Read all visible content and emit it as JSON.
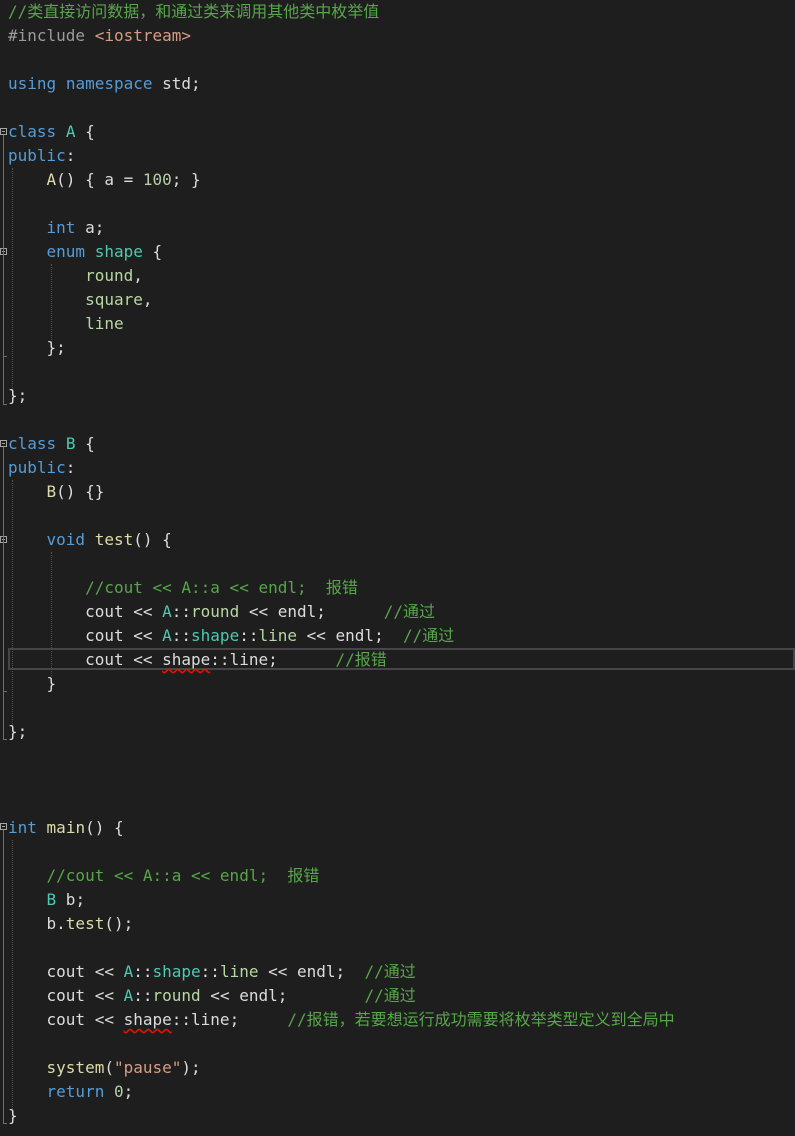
{
  "editor": {
    "language": "cpp",
    "lines": [
      {
        "row": 0,
        "tokens": [
          {
            "t": "//类直接访问数据，和通过类来调用其他类中枚举值",
            "c": "c"
          }
        ]
      },
      {
        "row": 1,
        "tokens": [
          {
            "t": "#include",
            "c": "p"
          },
          {
            "t": " <iostream>",
            "c": "s"
          }
        ]
      },
      {
        "row": 3,
        "tokens": [
          {
            "t": "using",
            "c": "k"
          },
          {
            "t": " ",
            "c": "v"
          },
          {
            "t": "namespace",
            "c": "k"
          },
          {
            "t": " std;",
            "c": "v"
          }
        ]
      },
      {
        "row": 5,
        "tokens": [
          {
            "t": "class",
            "c": "k"
          },
          {
            "t": " ",
            "c": "v"
          },
          {
            "t": "A",
            "c": "t"
          },
          {
            "t": " {",
            "c": "v"
          }
        ]
      },
      {
        "row": 6,
        "tokens": [
          {
            "t": "public",
            "c": "k"
          },
          {
            "t": ":",
            "c": "v"
          }
        ]
      },
      {
        "row": 7,
        "tokens": [
          {
            "t": "    ",
            "c": "v"
          },
          {
            "t": "A",
            "c": "f"
          },
          {
            "t": "() { a = ",
            "c": "v"
          },
          {
            "t": "100",
            "c": "n"
          },
          {
            "t": "; }",
            "c": "v"
          }
        ]
      },
      {
        "row": 9,
        "tokens": [
          {
            "t": "    ",
            "c": "v"
          },
          {
            "t": "int",
            "c": "k"
          },
          {
            "t": " a;",
            "c": "v"
          }
        ]
      },
      {
        "row": 10,
        "tokens": [
          {
            "t": "    ",
            "c": "v"
          },
          {
            "t": "enum",
            "c": "k"
          },
          {
            "t": " ",
            "c": "v"
          },
          {
            "t": "shape",
            "c": "t"
          },
          {
            "t": " {",
            "c": "v"
          }
        ]
      },
      {
        "row": 11,
        "tokens": [
          {
            "t": "        ",
            "c": "v"
          },
          {
            "t": "round",
            "c": "e"
          },
          {
            "t": ",",
            "c": "v"
          }
        ]
      },
      {
        "row": 12,
        "tokens": [
          {
            "t": "        ",
            "c": "v"
          },
          {
            "t": "square",
            "c": "e"
          },
          {
            "t": ",",
            "c": "v"
          }
        ]
      },
      {
        "row": 13,
        "tokens": [
          {
            "t": "        ",
            "c": "v"
          },
          {
            "t": "line",
            "c": "e"
          }
        ]
      },
      {
        "row": 14,
        "tokens": [
          {
            "t": "    };",
            "c": "v"
          }
        ]
      },
      {
        "row": 16,
        "tokens": [
          {
            "t": "};",
            "c": "v"
          }
        ]
      },
      {
        "row": 18,
        "tokens": [
          {
            "t": "class",
            "c": "k"
          },
          {
            "t": " ",
            "c": "v"
          },
          {
            "t": "B",
            "c": "t"
          },
          {
            "t": " {",
            "c": "v"
          }
        ]
      },
      {
        "row": 19,
        "tokens": [
          {
            "t": "public",
            "c": "k"
          },
          {
            "t": ":",
            "c": "v"
          }
        ]
      },
      {
        "row": 20,
        "tokens": [
          {
            "t": "    ",
            "c": "v"
          },
          {
            "t": "B",
            "c": "f"
          },
          {
            "t": "() {}",
            "c": "v"
          }
        ]
      },
      {
        "row": 22,
        "tokens": [
          {
            "t": "    ",
            "c": "v"
          },
          {
            "t": "void",
            "c": "k"
          },
          {
            "t": " ",
            "c": "v"
          },
          {
            "t": "test",
            "c": "f"
          },
          {
            "t": "() {",
            "c": "v"
          }
        ]
      },
      {
        "row": 24,
        "tokens": [
          {
            "t": "        ",
            "c": "v"
          },
          {
            "t": "//cout << A::a << endl;  报错",
            "c": "c"
          }
        ]
      },
      {
        "row": 25,
        "tokens": [
          {
            "t": "        cout << ",
            "c": "v"
          },
          {
            "t": "A",
            "c": "t"
          },
          {
            "t": "::",
            "c": "v"
          },
          {
            "t": "round",
            "c": "e"
          },
          {
            "t": " << endl;      ",
            "c": "v"
          },
          {
            "t": "//通过",
            "c": "c"
          }
        ]
      },
      {
        "row": 26,
        "tokens": [
          {
            "t": "        cout << ",
            "c": "v"
          },
          {
            "t": "A",
            "c": "t"
          },
          {
            "t": "::",
            "c": "v"
          },
          {
            "t": "shape",
            "c": "t"
          },
          {
            "t": "::",
            "c": "v"
          },
          {
            "t": "line",
            "c": "e"
          },
          {
            "t": " << endl;  ",
            "c": "v"
          },
          {
            "t": "//通过",
            "c": "c"
          }
        ]
      },
      {
        "row": 27,
        "tokens": [
          {
            "t": "        cout << ",
            "c": "v"
          },
          {
            "t": "shape",
            "c": "v",
            "sq": true
          },
          {
            "t": "::line;      ",
            "c": "v"
          },
          {
            "t": "//报错",
            "c": "c"
          }
        ]
      },
      {
        "row": 28,
        "tokens": [
          {
            "t": "    }",
            "c": "v"
          }
        ]
      },
      {
        "row": 30,
        "tokens": [
          {
            "t": "};",
            "c": "v"
          }
        ]
      },
      {
        "row": 34,
        "tokens": [
          {
            "t": "int",
            "c": "k"
          },
          {
            "t": " ",
            "c": "v"
          },
          {
            "t": "main",
            "c": "f"
          },
          {
            "t": "() {",
            "c": "v"
          }
        ]
      },
      {
        "row": 36,
        "tokens": [
          {
            "t": "    ",
            "c": "v"
          },
          {
            "t": "//cout << A::a << endl;  报错",
            "c": "c"
          }
        ]
      },
      {
        "row": 37,
        "tokens": [
          {
            "t": "    ",
            "c": "v"
          },
          {
            "t": "B",
            "c": "t"
          },
          {
            "t": " b;",
            "c": "v"
          }
        ]
      },
      {
        "row": 38,
        "tokens": [
          {
            "t": "    b.",
            "c": "v"
          },
          {
            "t": "test",
            "c": "f"
          },
          {
            "t": "();",
            "c": "v"
          }
        ]
      },
      {
        "row": 40,
        "tokens": [
          {
            "t": "    cout << ",
            "c": "v"
          },
          {
            "t": "A",
            "c": "t"
          },
          {
            "t": "::",
            "c": "v"
          },
          {
            "t": "shape",
            "c": "t"
          },
          {
            "t": "::",
            "c": "v"
          },
          {
            "t": "line",
            "c": "e"
          },
          {
            "t": " << endl;  ",
            "c": "v"
          },
          {
            "t": "//通过",
            "c": "c"
          }
        ]
      },
      {
        "row": 41,
        "tokens": [
          {
            "t": "    cout << ",
            "c": "v"
          },
          {
            "t": "A",
            "c": "t"
          },
          {
            "t": "::",
            "c": "v"
          },
          {
            "t": "round",
            "c": "e"
          },
          {
            "t": " << endl;        ",
            "c": "v"
          },
          {
            "t": "//通过",
            "c": "c"
          }
        ]
      },
      {
        "row": 42,
        "tokens": [
          {
            "t": "    cout << ",
            "c": "v"
          },
          {
            "t": "shape",
            "c": "v",
            "sq": true
          },
          {
            "t": "::line;     ",
            "c": "v"
          },
          {
            "t": "//报错，若要想运行成功需要将枚举类型定义到全局中",
            "c": "c"
          }
        ]
      },
      {
        "row": 44,
        "tokens": [
          {
            "t": "    ",
            "c": "v"
          },
          {
            "t": "system",
            "c": "f"
          },
          {
            "t": "(",
            "c": "v"
          },
          {
            "t": "\"pause\"",
            "c": "s"
          },
          {
            "t": ");",
            "c": "v"
          }
        ]
      },
      {
        "row": 45,
        "tokens": [
          {
            "t": "    ",
            "c": "v"
          },
          {
            "t": "return",
            "c": "k"
          },
          {
            "t": " ",
            "c": "v"
          },
          {
            "t": "0",
            "c": "n"
          },
          {
            "t": ";",
            "c": "v"
          }
        ]
      },
      {
        "row": 46,
        "tokens": [
          {
            "t": "}",
            "c": "v"
          }
        ]
      }
    ]
  },
  "colors": {
    "background": "#1e1e1e",
    "keyword": "#569cd6",
    "type": "#4ec9b0",
    "function": "#dcdcaa",
    "comment": "#57a64a",
    "string": "#d69d85",
    "number": "#b5cea8",
    "preprocessor": "#9b9b9b",
    "enum_member": "#b8d7a3",
    "identifier": "#dcdcdc",
    "error_squiggle": "#e51400",
    "current_line_border": "#464646"
  },
  "icons": {
    "fold_marker": "collapse-minus-box-icon"
  }
}
